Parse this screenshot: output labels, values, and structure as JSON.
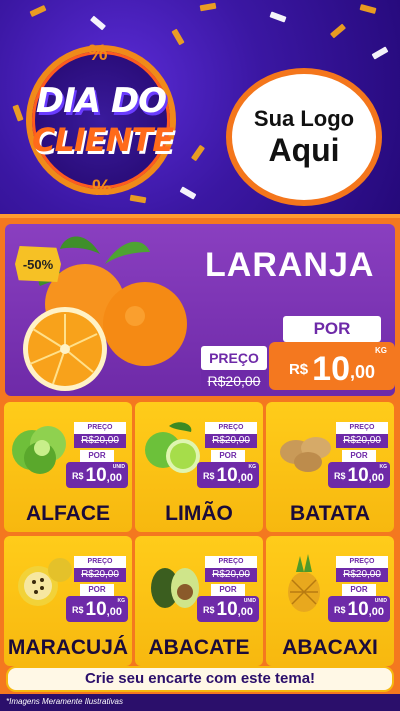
{
  "header": {
    "badge_line1": "DIA DO",
    "badge_line2": "CLIENTE",
    "percent_symbol": "%",
    "logo_line1": "Sua Logo",
    "logo_line2": "Aqui"
  },
  "hero": {
    "discount": "-50%",
    "name": "LARANJA",
    "preco_label": "PREÇO",
    "old_price": "R$20,00",
    "por_label": "POR",
    "currency": "R$",
    "price_int": "10",
    "price_dec": ",00",
    "unit": "KG"
  },
  "products": [
    {
      "name": "ALFACE",
      "preco_label": "PREÇO",
      "old_price": "R$20,00",
      "por_label": "POR",
      "currency": "R$",
      "price_int": "10",
      "price_dec": ",00",
      "unit": "UNID",
      "icon": "lettuce-icon"
    },
    {
      "name": "LIMÃO",
      "preco_label": "PREÇO",
      "old_price": "R$20,00",
      "por_label": "POR",
      "currency": "R$",
      "price_int": "10",
      "price_dec": ",00",
      "unit": "KG",
      "icon": "lime-icon"
    },
    {
      "name": "BATATA",
      "preco_label": "PREÇO",
      "old_price": "R$20,00",
      "por_label": "POR",
      "currency": "R$",
      "price_int": "10",
      "price_dec": ",00",
      "unit": "KG",
      "icon": "potato-icon"
    },
    {
      "name": "MARACUJÁ",
      "preco_label": "PREÇO",
      "old_price": "R$20,00",
      "por_label": "POR",
      "currency": "R$",
      "price_int": "10",
      "price_dec": ",00",
      "unit": "KG",
      "icon": "passion-fruit-icon"
    },
    {
      "name": "ABACATE",
      "preco_label": "PREÇO",
      "old_price": "R$20,00",
      "por_label": "POR",
      "currency": "R$",
      "price_int": "10",
      "price_dec": ",00",
      "unit": "UNID",
      "icon": "avocado-icon"
    },
    {
      "name": "ABACAXI",
      "preco_label": "PREÇO",
      "old_price": "R$20,00",
      "por_label": "POR",
      "currency": "R$",
      "price_int": "10",
      "price_dec": ",00",
      "unit": "UNID",
      "icon": "pineapple-icon"
    }
  ],
  "footer": {
    "banner": "Crie seu encarte com este tema!",
    "disclaimer": "*Imagens Meramente Ilustrativas"
  },
  "colors": {
    "purple": "#6e2aa8",
    "orange": "#f4781f",
    "yellow": "#f7b80f",
    "header_blue": "#3b17a3"
  }
}
